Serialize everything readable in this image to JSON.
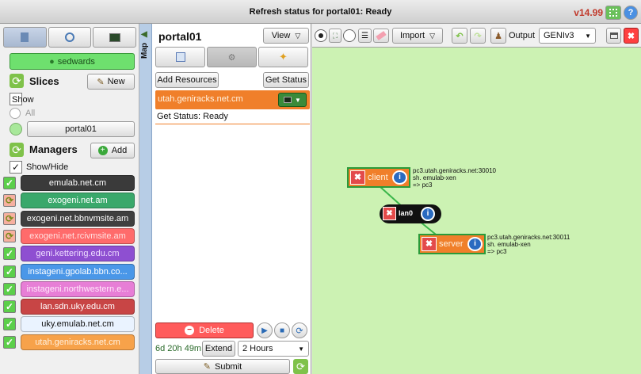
{
  "status_bar": {
    "title": "Refresh status for portal01: Ready",
    "version": "v14.99"
  },
  "sidebar": {
    "user": "sedwards",
    "slices_heading": "Slices",
    "new_label": "New",
    "show_label": "Show",
    "all_label": "All",
    "slice_name": "portal01",
    "managers_heading": "Managers",
    "add_label": "Add",
    "show_hide_label": "Show/Hide",
    "managers": [
      {
        "name": "emulab.net.cm",
        "bg": "#3a3a3a",
        "fg": "#ffffff",
        "status": "ok"
      },
      {
        "name": "exogeni.net.am",
        "bg": "#3aa86b",
        "fg": "#ffffff",
        "status": "busy"
      },
      {
        "name": "exogeni.net.bbnvmsite.am",
        "bg": "#3f3f3f",
        "fg": "#ffffff",
        "status": "busy"
      },
      {
        "name": "exogeni.net.rcivmsite.am",
        "bg": "#ff6b6b",
        "fg": "#ffe0e0",
        "status": "busy"
      },
      {
        "name": "geni.kettering.edu.cm",
        "bg": "#8e4fd1",
        "fg": "#eedcff",
        "status": "ok"
      },
      {
        "name": "instageni.gpolab.bbn.co...",
        "bg": "#4a97e8",
        "fg": "#ffffff",
        "status": "ok"
      },
      {
        "name": "instageni.northwestern.e...",
        "bg": "#e77ed6",
        "fg": "#ffe8fa",
        "status": "ok"
      },
      {
        "name": "lan.sdn.uky.edu.cm",
        "bg": "#c84545",
        "fg": "#ffffff",
        "status": "ok"
      },
      {
        "name": "uky.emulab.net.cm",
        "bg": "#eaf3ff",
        "fg": "#111111",
        "status": "ok"
      },
      {
        "name": "utah.geniracks.net.cm",
        "bg": "#f7a24a",
        "fg": "#fff0df",
        "status": "ok"
      }
    ]
  },
  "map_tab": "Map",
  "slice_panel": {
    "title": "portal01",
    "view_label": "View",
    "add_resources": "Add Resources",
    "get_status": "Get Status",
    "manager_row": "utah.geniracks.net.cm",
    "status_line": "Get Status: Ready",
    "delete_label": "Delete",
    "time_left": "6d 20h 49m",
    "extend_label": "Extend",
    "extend_duration": "2 Hours",
    "submit_label": "Submit"
  },
  "toolbar": {
    "import_label": "Import",
    "output_label": "Output",
    "output_value": "GENIv3"
  },
  "canvas": {
    "client": {
      "label": "client",
      "info": "pc3.utah.geniracks.net:30010\nsh. emulab-xen\n=> pc3"
    },
    "lan": {
      "label": "lan0"
    },
    "server": {
      "label": "server",
      "info": "pc3.utah.geniracks.net:30011\nsh. emulab-xen\n=> pc3"
    }
  },
  "colors": {
    "canvas_bg": "#ccf2b3",
    "node_orange": "#f07f2a",
    "user_green": "#6ee06e",
    "link_green": "#3ab54a"
  }
}
